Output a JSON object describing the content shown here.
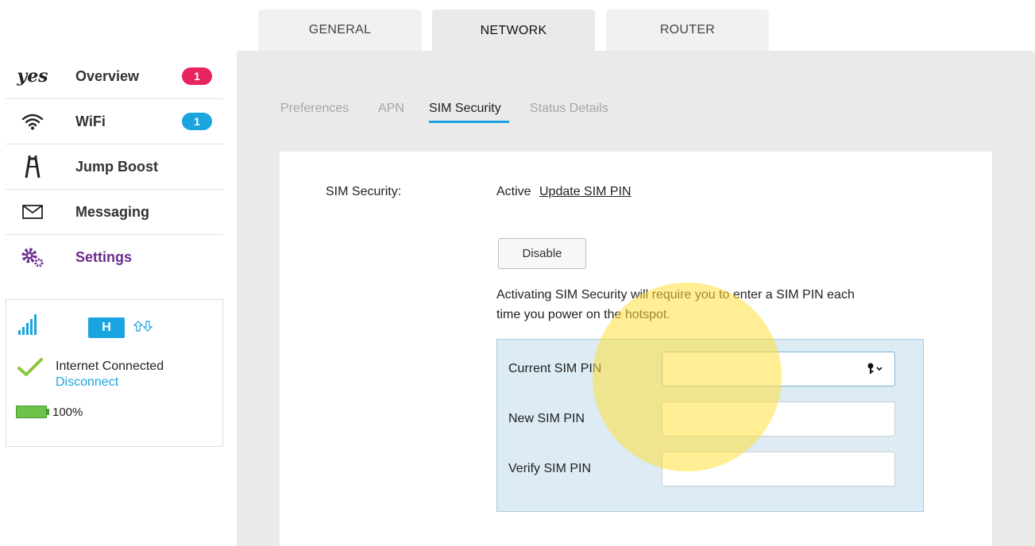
{
  "top_tabs": [
    {
      "label": "GENERAL",
      "active": false
    },
    {
      "label": "NETWORK",
      "active": true
    },
    {
      "label": "ROUTER",
      "active": false
    }
  ],
  "sidebar": {
    "logo_text": "yes",
    "items": [
      {
        "label": "Overview",
        "icon": "yes-logo",
        "badge": "1",
        "badge_color": "#e8245f"
      },
      {
        "label": "WiFi",
        "icon": "wifi-icon",
        "badge": "1",
        "badge_color": "#1aa5e0"
      },
      {
        "label": "Jump Boost",
        "icon": "jump-boost-icon"
      },
      {
        "label": "Messaging",
        "icon": "envelope-icon"
      },
      {
        "label": "Settings",
        "icon": "gears-icon",
        "active": true,
        "active_color": "#6a2c8f"
      }
    ]
  },
  "status": {
    "network_type": "H",
    "connection_text": "Internet Connected",
    "disconnect_label": "Disconnect",
    "battery": "100%",
    "battery_level": 1.0,
    "signal_color": "#1aa5e0",
    "check_color": "#8cc63f",
    "battery_color": "#6cc24a"
  },
  "sub_tabs": [
    {
      "label": "Preferences",
      "active": false
    },
    {
      "label": "APN",
      "active": false
    },
    {
      "label": "SIM Security",
      "active": true
    },
    {
      "label": "Status Details",
      "active": false
    }
  ],
  "sim_security": {
    "label": "SIM Security:",
    "status": "Active",
    "update_link": "Update SIM PIN",
    "disable_button": "Disable",
    "description_line1": "Activating SIM Security will require you to enter a SIM PIN each",
    "description_line2": "time you power on the hotspot.",
    "fields": [
      {
        "label": "Current SIM PIN",
        "value": ""
      },
      {
        "label": "New SIM PIN",
        "value": ""
      },
      {
        "label": "Verify SIM PIN",
        "value": ""
      }
    ]
  },
  "colors": {
    "accent_blue": "#1aa5e0",
    "settings_purple": "#6a2c8f",
    "panel_grey": "#eaeaea",
    "pin_box_bg": "#dcebf4",
    "highlight_yellow": "#ffe03c"
  }
}
